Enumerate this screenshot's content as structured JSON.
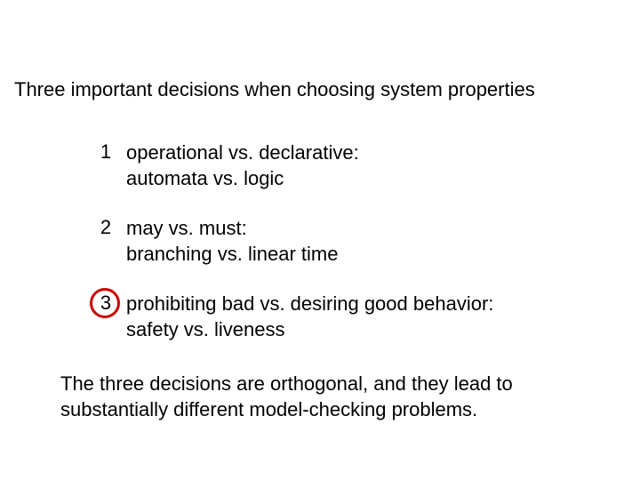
{
  "title": "Three important decisions when choosing system properties",
  "items": [
    {
      "number": "1",
      "line1": "operational vs. declarative:",
      "line2": "automata vs. logic",
      "circled": false
    },
    {
      "number": "2",
      "line1": "may vs. must:",
      "line2": "branching vs. linear time",
      "circled": false
    },
    {
      "number": "3",
      "line1": "prohibiting bad vs. desiring good behavior:",
      "line2": "safety vs. liveness",
      "circled": true
    }
  ],
  "footer": "The three decisions are orthogonal, and they lead to substantially different model-checking problems.",
  "highlight_color": "#cc0000"
}
